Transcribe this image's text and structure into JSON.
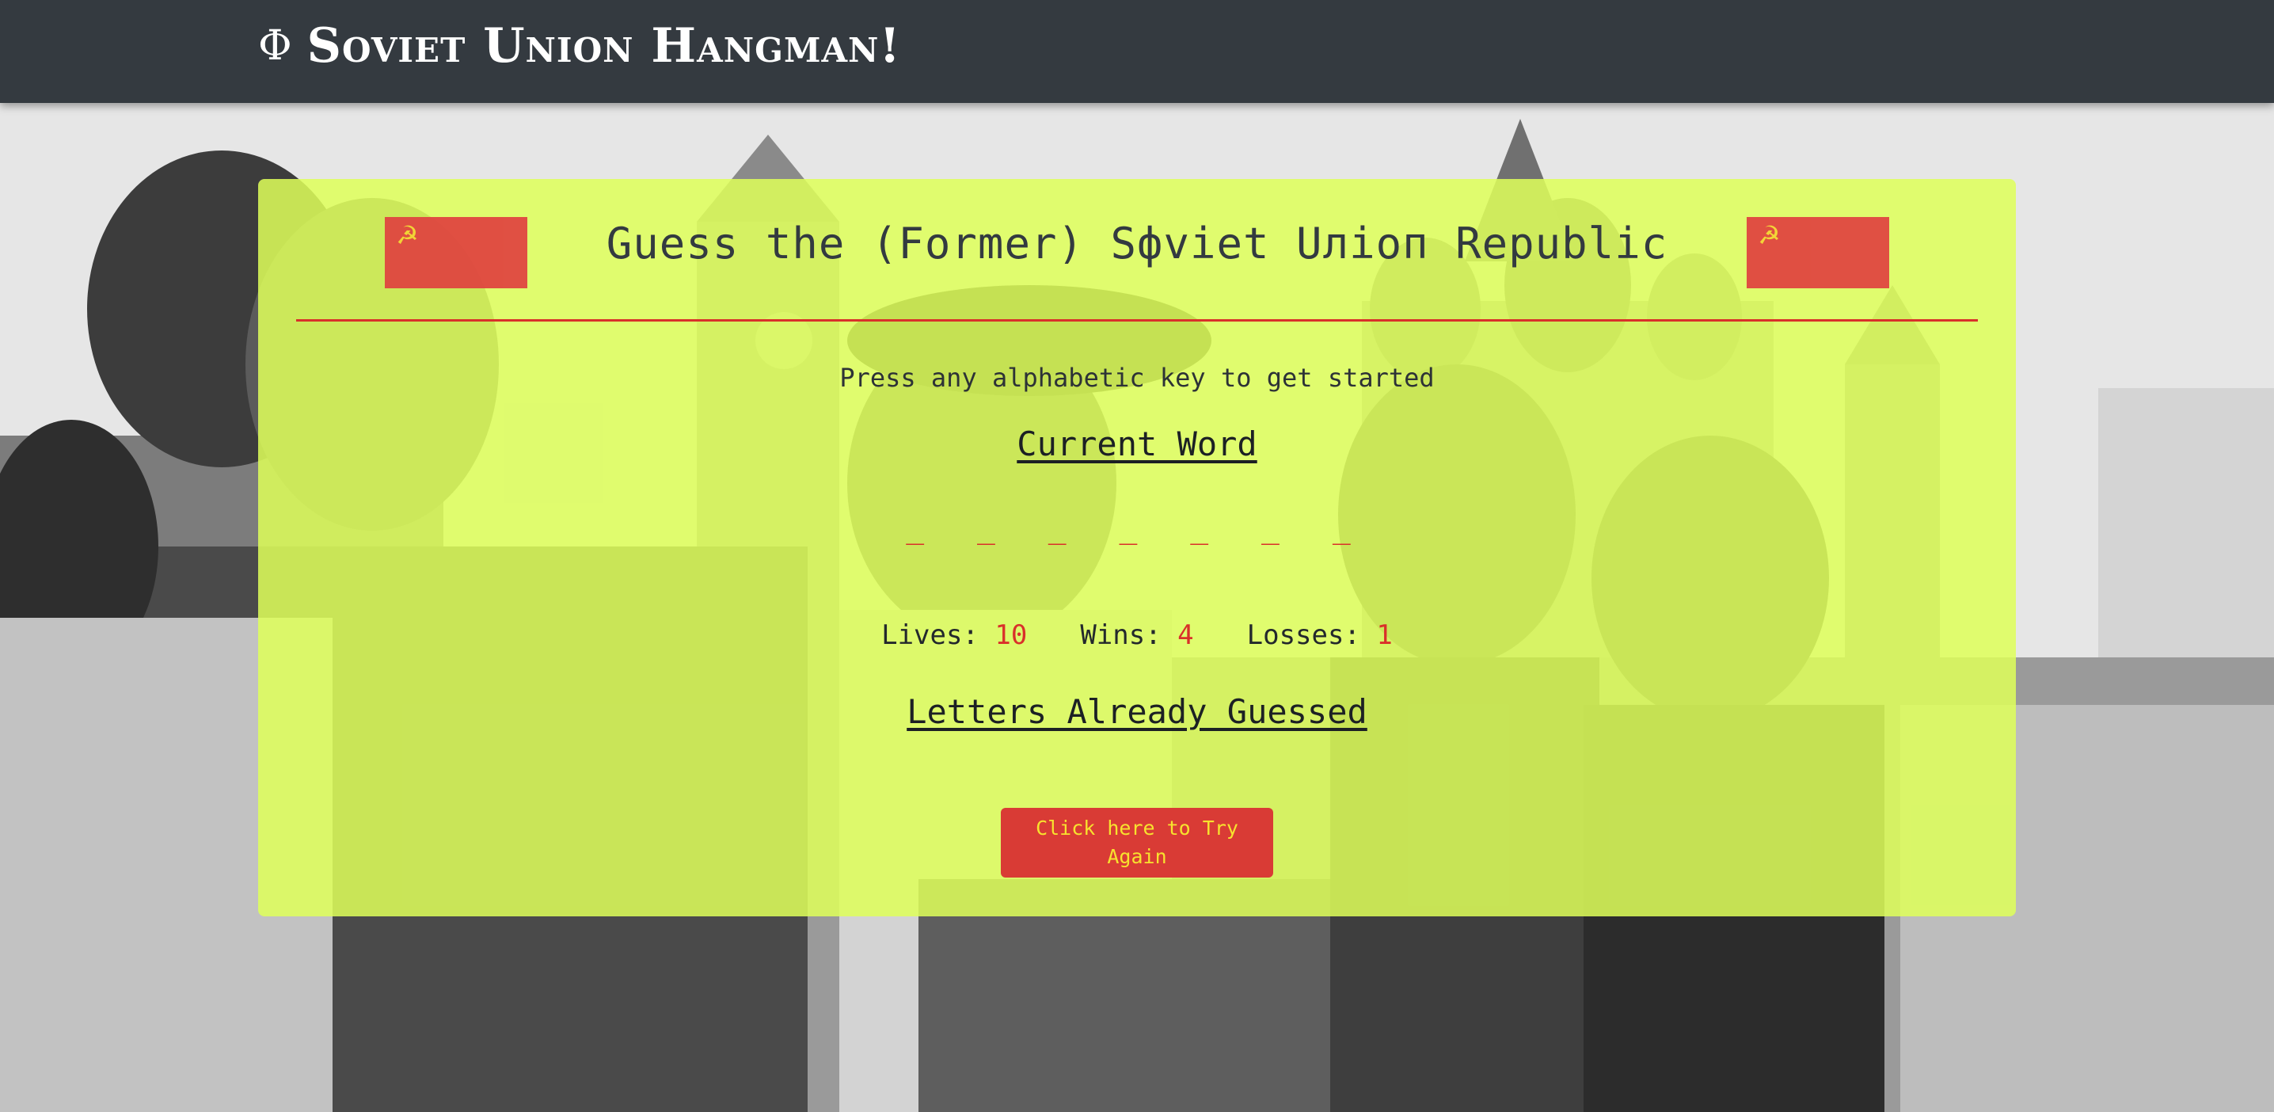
{
  "navbar": {
    "brand_icon": "Φ",
    "brand_title": "Soviet Union Hangman!"
  },
  "game": {
    "flag_emblem": "☭",
    "title": "Guess the (Former) Sфviet Uлioп Republic",
    "prompt": "Press any alphabetic key to get started",
    "current_word_heading": "Current Word",
    "word_blanks": "_ _ _ _ _ _ _",
    "stats": {
      "lives_label": "Lives:",
      "lives_value": "10",
      "wins_label": "Wins:",
      "wins_value": "4",
      "losses_label": "Losses:",
      "losses_value": "1"
    },
    "letters_guessed_heading": "Letters Already Guessed",
    "try_again_label": "Click here to Try Again"
  },
  "colors": {
    "navbar": "#343a40",
    "card": "#deff5a",
    "accent_red": "#d9302a",
    "button_text": "#f7e22e"
  },
  "icons": {
    "brand": "phi-symbol",
    "flag_emblem": "hammer-and-sickle-icon"
  }
}
